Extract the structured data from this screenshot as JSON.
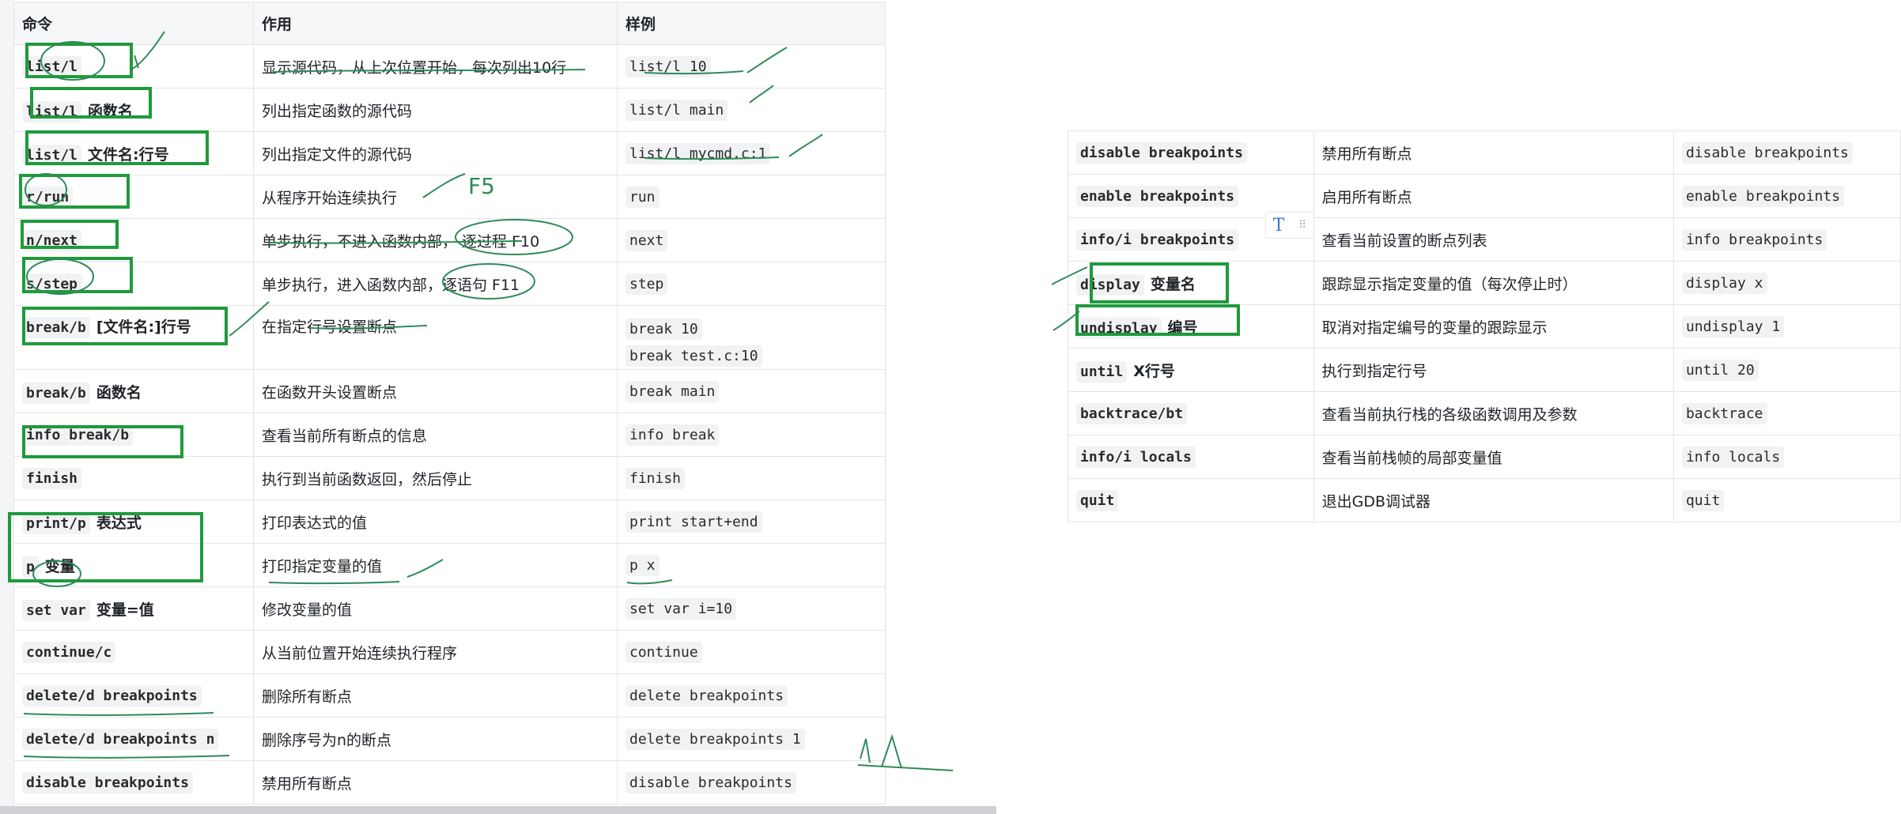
{
  "left_table": {
    "headers": [
      "命令",
      "作用",
      "样例"
    ],
    "rows": [
      {
        "cmd": "list/l",
        "cmd_bold": "",
        "desc": "显示源代码，从上次位置开始，每次列出10行",
        "examples": [
          "list/l 10"
        ]
      },
      {
        "cmd": "list/l",
        "cmd_bold": "函数名",
        "desc": "列出指定函数的源代码",
        "examples": [
          "list/l main"
        ]
      },
      {
        "cmd": "list/l",
        "cmd_bold": "文件名:行号",
        "desc": "列出指定文件的源代码",
        "examples": [
          "list/l mycmd.c:1"
        ]
      },
      {
        "cmd": "r/run",
        "cmd_bold": "",
        "desc": "从程序开始连续执行",
        "examples": [
          "run"
        ]
      },
      {
        "cmd": "n/next",
        "cmd_bold": "",
        "desc": "单步执行，不进入函数内部， 逐过程 F10",
        "examples": [
          "next"
        ]
      },
      {
        "cmd": "s/step",
        "cmd_bold": "",
        "desc": "单步执行，进入函数内部，逐语句 F11",
        "examples": [
          "step"
        ]
      },
      {
        "cmd": "break/b",
        "cmd_bold": "[文件名:]行号",
        "desc": "在指定行号设置断点",
        "examples": [
          "break 10",
          "break test.c:10"
        ]
      },
      {
        "cmd": "break/b",
        "cmd_bold": "函数名",
        "desc": "在函数开头设置断点",
        "examples": [
          "break main"
        ]
      },
      {
        "cmd": "info break/b",
        "cmd_bold": "",
        "desc": "查看当前所有断点的信息",
        "examples": [
          "info break"
        ]
      },
      {
        "cmd": "finish",
        "cmd_bold": "",
        "desc": "执行到当前函数返回，然后停止",
        "examples": [
          "finish"
        ]
      },
      {
        "cmd": "print/p",
        "cmd_bold": "表达式",
        "desc": "打印表达式的值",
        "examples": [
          "print start+end"
        ]
      },
      {
        "cmd": "p",
        "cmd_bold": "变量",
        "desc": "打印指定变量的值",
        "examples": [
          "p x"
        ]
      },
      {
        "cmd": "set var",
        "cmd_bold": "变量=值",
        "desc": "修改变量的值",
        "examples": [
          "set var i=10"
        ]
      },
      {
        "cmd": "continue/c",
        "cmd_bold": "",
        "desc": "从当前位置开始连续执行程序",
        "examples": [
          "continue"
        ]
      },
      {
        "cmd": "delete/d breakpoints",
        "cmd_bold": "",
        "desc": "删除所有断点",
        "examples": [
          "delete breakpoints"
        ]
      },
      {
        "cmd": "delete/d breakpoints n",
        "cmd_bold": "",
        "desc": "删除序号为n的断点",
        "examples": [
          "delete breakpoints 1"
        ]
      },
      {
        "cmd": "disable breakpoints",
        "cmd_bold": "",
        "desc": "禁用所有断点",
        "examples": [
          "disable breakpoints"
        ]
      }
    ]
  },
  "right_table": {
    "rows": [
      {
        "cmd": "disable breakpoints",
        "cmd_bold": "",
        "desc": "禁用所有断点",
        "examples": [
          "disable breakpoints"
        ]
      },
      {
        "cmd": "enable breakpoints",
        "cmd_bold": "",
        "desc": "启用所有断点",
        "examples": [
          "enable breakpoints"
        ]
      },
      {
        "cmd": "info/i breakpoints",
        "cmd_bold": "",
        "desc": "查看当前设置的断点列表",
        "examples": [
          "info breakpoints"
        ]
      },
      {
        "cmd": "display",
        "cmd_bold": "变量名",
        "desc": "跟踪显示指定变量的值（每次停止时）",
        "examples": [
          "display x"
        ]
      },
      {
        "cmd": "undisplay",
        "cmd_bold": "编号",
        "desc": "取消对指定编号的变量的跟踪显示",
        "examples": [
          "undisplay 1"
        ]
      },
      {
        "cmd": "until",
        "cmd_bold": "X行号",
        "desc": "执行到指定行号",
        "examples": [
          "until 20"
        ]
      },
      {
        "cmd": "backtrace/bt",
        "cmd_bold": "",
        "desc": "查看当前执行栈的各级函数调用及参数",
        "examples": [
          "backtrace"
        ]
      },
      {
        "cmd": "info/i locals",
        "cmd_bold": "",
        "desc": "查看当前栈帧的局部变量值",
        "examples": [
          "info locals"
        ]
      },
      {
        "cmd": "quit",
        "cmd_bold": "",
        "desc": "退出GDB调试器",
        "examples": [
          "quit"
        ]
      }
    ]
  },
  "annotations": {
    "f5": "F5"
  },
  "toolbar": {
    "text_tool_glyph": "T",
    "grip_glyph": "⠿"
  },
  "colors": {
    "box": "#1f9a3c",
    "ink": "#2e8b57",
    "ink_blue": "#2f5fb0"
  }
}
